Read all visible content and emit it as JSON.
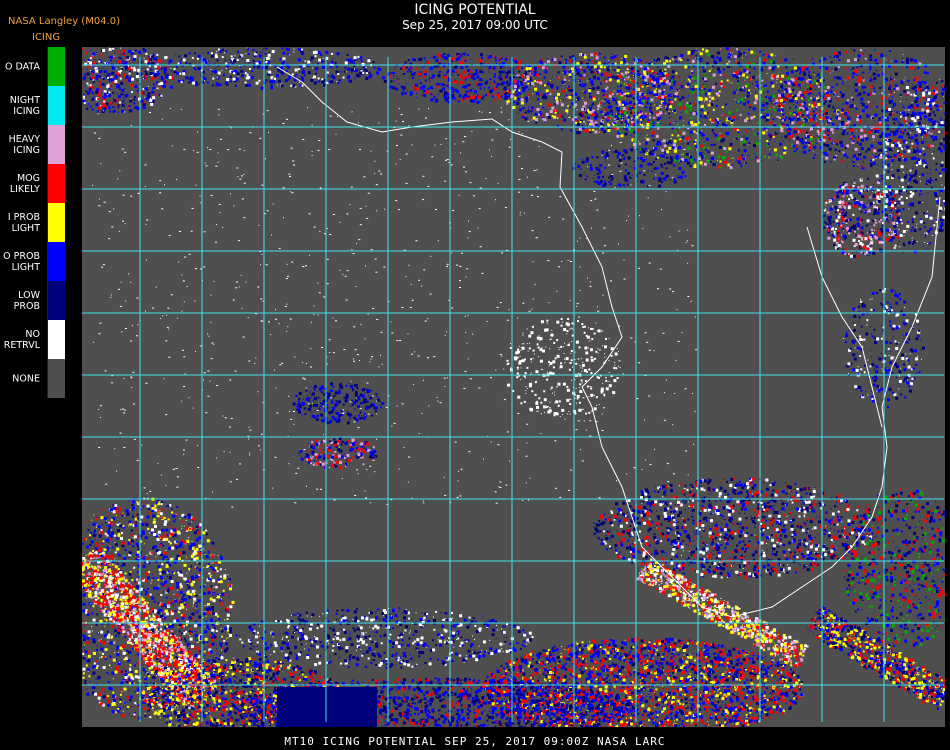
{
  "header": {
    "provider": "NASA Langley (M04.0)",
    "product": "ICING",
    "title": "ICING POTENTIAL",
    "datetime": "Sep 25, 2017 09:00 UTC"
  },
  "legend": {
    "items": [
      {
        "label": "O DATA",
        "color": "#00b000"
      },
      {
        "label": "NIGHT\nICING",
        "color": "#00e8f0"
      },
      {
        "label": "HEAVY\nICING",
        "color": "#e0a0d8"
      },
      {
        "label": "MOG\nLIKELY",
        "color": "#ff0000"
      },
      {
        "label": "I PROB\nLIGHT",
        "color": "#ffff00"
      },
      {
        "label": "O PROB\nLIGHT",
        "color": "#0000ff"
      },
      {
        "label": "LOW\nPROB",
        "color": "#00007a"
      },
      {
        "label": "NO\nRETRVL",
        "color": "#ffffff"
      },
      {
        "label": "NONE",
        "color": "#4f4f4f"
      }
    ]
  },
  "map": {
    "background_color": "#4f4f4f",
    "grid_color": "#40e0f0",
    "coast_color": "#ffffff"
  },
  "footer": {
    "caption": "MT10  ICING POTENTIAL   SEP 25, 2017 09:00Z   NASA LARC"
  }
}
